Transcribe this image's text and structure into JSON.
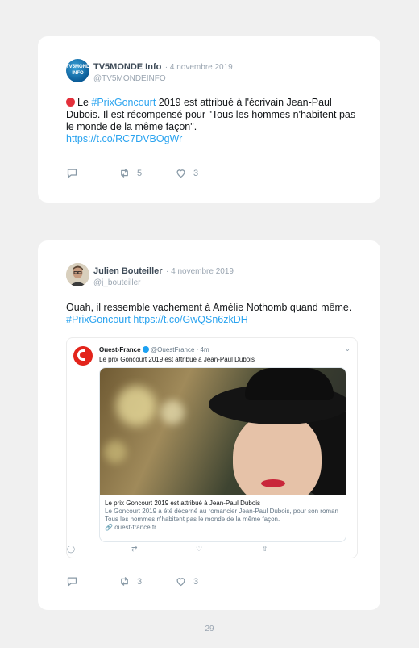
{
  "tweets": [
    {
      "name": "TV5MONDE Info",
      "date": "· 4 novembre 2019",
      "handle": "@TV5MONDEINFO",
      "avatar_label": "TV5MONDE INFO",
      "text_before": "Le ",
      "hashtag": "#PrixGoncourt",
      "text_after": " 2019 est attribué à l'écrivain Jean-Paul Dubois. Il est récompensé pour \"Tous les hommes n'habitent pas le monde de la même façon\".",
      "url": "https://t.co/RC7DVBOgWr",
      "retweets": "5",
      "likes": "3"
    },
    {
      "name": "Julien Bouteiller",
      "date": "· 4 novembre 2019",
      "handle": "@j_bouteiller",
      "text": "Ouah, il ressemble vachement à Amélie Nothomb quand même. ",
      "hashtag": "#PrixGoncourt",
      "url": "https://t.co/GwQSn6zkDH",
      "retweets": "3",
      "likes": "3",
      "embed": {
        "name": "Ouest-France",
        "handle": "@OuestFrance · 4m",
        "text": "Le prix Goncourt 2019 est attribué à Jean-Paul Dubois",
        "card_title": "Le prix Goncourt 2019 est attribué à Jean-Paul Dubois",
        "card_desc": "Le Goncourt 2019 a été décerné au romancier Jean-Paul Dubois, pour son roman Tous les hommes n'habitent pas le monde de la même façon.",
        "card_domain": "ouest-france.fr"
      }
    }
  ],
  "page_number": "29",
  "colors": {
    "link": "#2aa3ef",
    "background": "#f0f0f0",
    "card": "#ffffff"
  }
}
